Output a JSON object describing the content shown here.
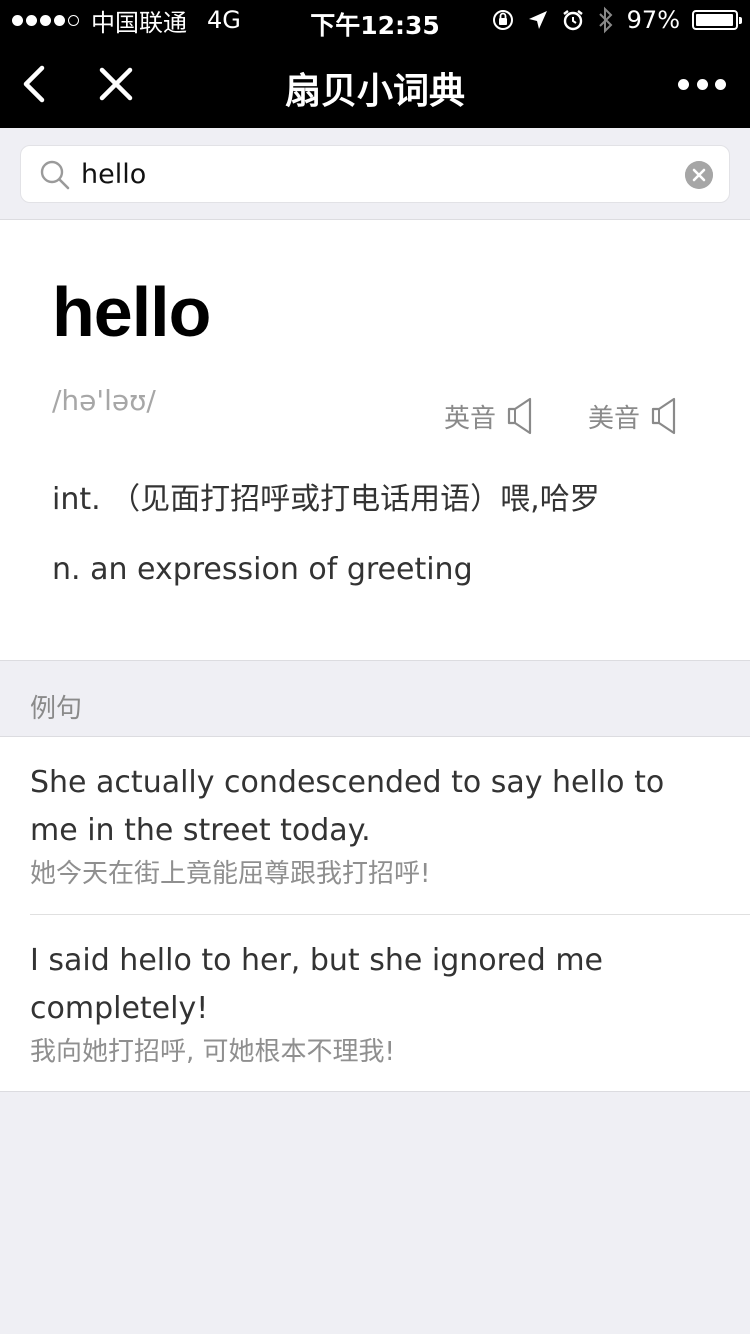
{
  "status_bar": {
    "carrier": "中国联通",
    "network": "4G",
    "time": "下午12:35",
    "battery": "97%",
    "battery_level": 0.97,
    "icons": [
      "orientation-lock-icon",
      "location-icon",
      "alarm-icon",
      "bluetooth-icon",
      "battery-icon"
    ]
  },
  "nav": {
    "title": "扇贝小词典",
    "icons": [
      "back-icon",
      "close-icon",
      "more-icon"
    ]
  },
  "search": {
    "value": "hello",
    "icons": [
      "search-icon",
      "clear-icon"
    ]
  },
  "entry": {
    "word": "hello",
    "phonetic": "/hə'ləʊ/",
    "pron_uk_label": "英音",
    "pron_us_label": "美音",
    "definitions": [
      "int. （见面打招呼或打电话用语）喂,哈罗",
      "n. an expression of greeting"
    ]
  },
  "examples_section": {
    "title": "例句",
    "items": [
      {
        "en": "She actually condescended to say hello to me in the street today.",
        "zh": "她今天在街上竟能屈尊跟我打招呼!"
      },
      {
        "en": "I said hello to her, but she ignored me completely!",
        "zh": "我向她打招呼, 可她根本不理我!"
      }
    ]
  },
  "colors": {
    "nav_background": "#000000",
    "page_background": "#efeff4",
    "secondary_text": "#8a8a8a"
  }
}
